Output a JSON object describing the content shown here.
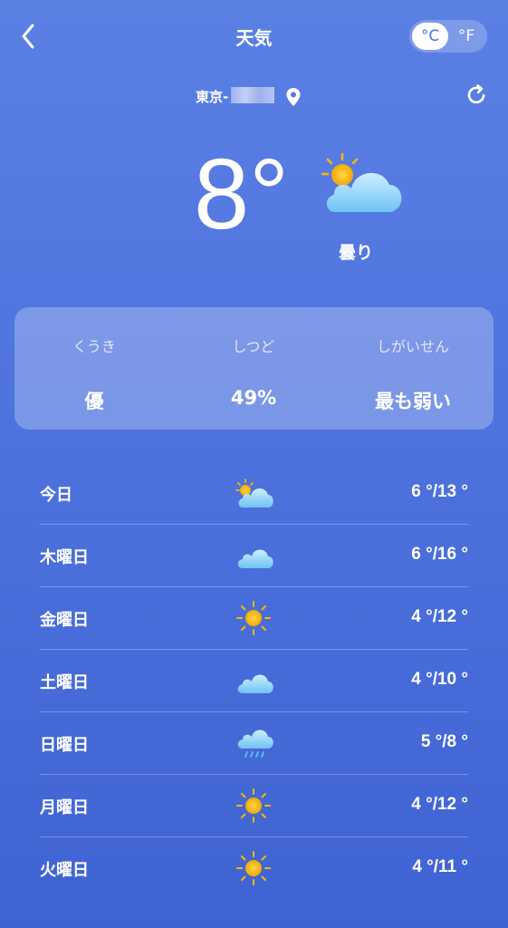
{
  "header": {
    "title": "天気",
    "unit_celsius": "°C",
    "unit_fahrenheit": "°F"
  },
  "location": {
    "name": "東京-"
  },
  "current": {
    "temperature": "8°",
    "condition": "曇り",
    "icon": "sun-cloud-icon"
  },
  "info": [
    {
      "label": "くうき",
      "value": "優"
    },
    {
      "label": "しつど",
      "value": "49%"
    },
    {
      "label": "しがいせん",
      "value": "最も弱い"
    }
  ],
  "forecast": [
    {
      "day": "今日",
      "icon": "sun-cloud-icon",
      "temp": "6 °/13 °"
    },
    {
      "day": "木曜日",
      "icon": "cloud-icon",
      "temp": "6 °/16 °"
    },
    {
      "day": "金曜日",
      "icon": "sun-icon",
      "temp": "4 °/12 °"
    },
    {
      "day": "土曜日",
      "icon": "cloud-icon",
      "temp": "4 °/10 °"
    },
    {
      "day": "日曜日",
      "icon": "rain-cloud-icon",
      "temp": "5 °/8 °"
    },
    {
      "day": "月曜日",
      "icon": "sun-icon",
      "temp": "4 °/12 °"
    },
    {
      "day": "火曜日",
      "icon": "sun-icon",
      "temp": "4 °/11 °"
    }
  ],
  "colors": {
    "background_top": "#5b80e4",
    "background_bottom": "#3f63d2",
    "sun": "#f5b800",
    "cloud": "#8fd3fa"
  }
}
